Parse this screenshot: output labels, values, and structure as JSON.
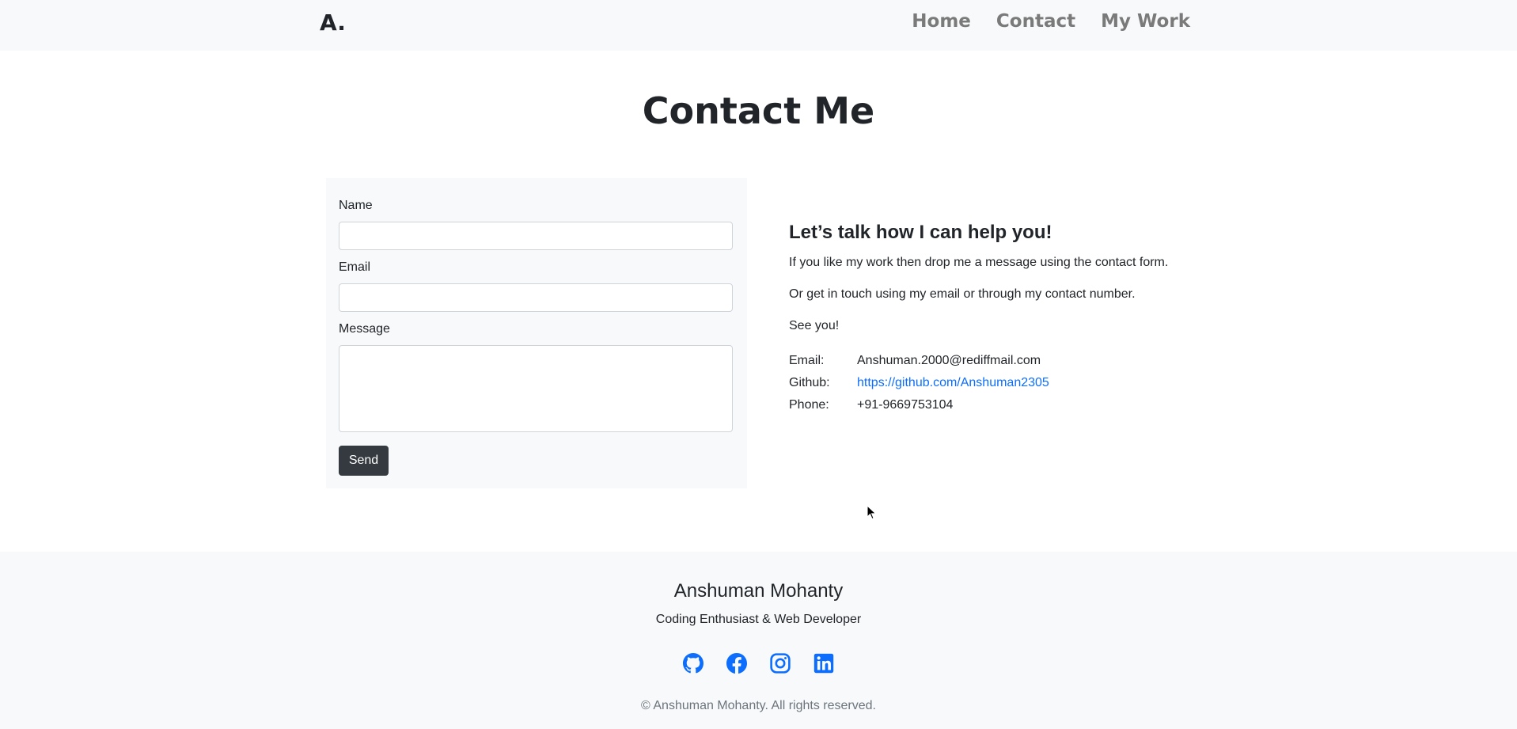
{
  "navbar": {
    "brand": "A.",
    "links": [
      {
        "label": "Home"
      },
      {
        "label": "Contact"
      },
      {
        "label": "My Work"
      }
    ]
  },
  "page_title": "Contact Me",
  "form": {
    "name_label": "Name",
    "name_value": "",
    "email_label": "Email",
    "email_value": "",
    "message_label": "Message",
    "message_value": "",
    "send_label": "Send"
  },
  "info": {
    "heading": "Let’s talk how I can help you!",
    "paragraphs": [
      "If you like my work then drop me a message using the contact form.",
      "Or get in touch using my email or through my contact number.",
      "See you!"
    ],
    "contacts": [
      {
        "key": "Email:",
        "value": "Anshuman.2000@rediffmail.com"
      },
      {
        "key": "Github:",
        "value": "https://github.com/Anshuman2305"
      },
      {
        "key": "Phone:",
        "value": "+91-9669753104"
      }
    ]
  },
  "footer": {
    "name": "Anshuman Mohanty",
    "tagline": "Coding Enthusiast & Web Developer",
    "socials": [
      {
        "icon": "github-icon"
      },
      {
        "icon": "facebook-icon"
      },
      {
        "icon": "instagram-icon"
      },
      {
        "icon": "linkedin-icon"
      }
    ],
    "copyright": "© Anshuman Mohanty. All rights reserved."
  },
  "colors": {
    "accent": "#0d6efd",
    "button": "#343a40",
    "panel": "#f8f9fa"
  }
}
